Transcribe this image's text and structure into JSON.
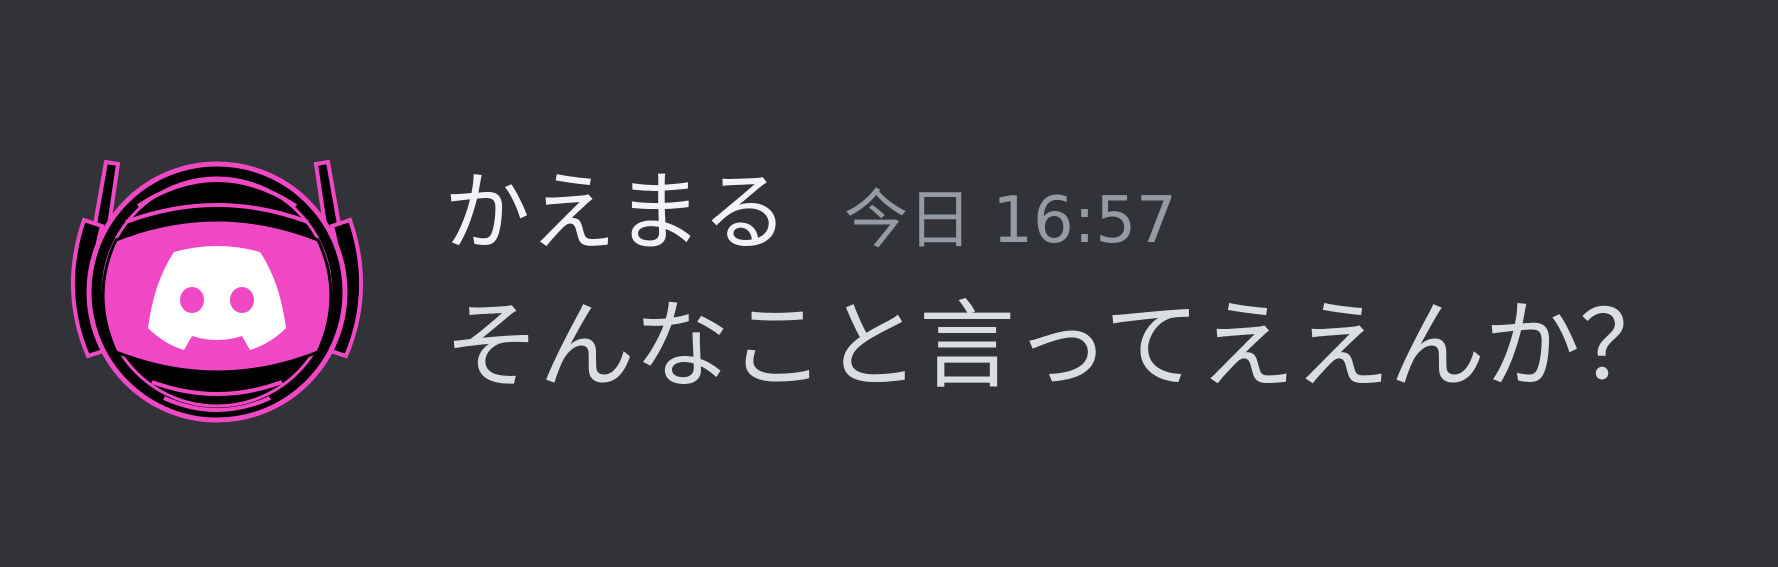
{
  "message": {
    "author": "かえまる",
    "timestamp": "今日 16:57",
    "text": "そんなこと言ってええんか？"
  },
  "avatar": {
    "icon": "discord-bot-avatar-icon",
    "accent_color": "#f048c4",
    "background_color": "#000000"
  },
  "theme": {
    "background": "#313338",
    "username_color": "#f2f3f5",
    "timestamp_color": "#949ba4",
    "text_color": "#dbdee1"
  }
}
